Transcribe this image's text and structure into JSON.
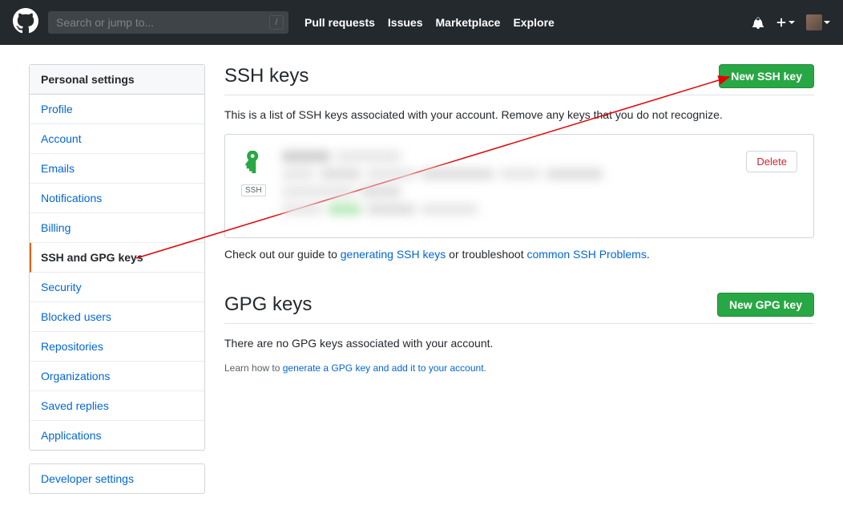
{
  "header": {
    "search_placeholder": "Search or jump to...",
    "nav": [
      "Pull requests",
      "Issues",
      "Marketplace",
      "Explore"
    ]
  },
  "sidebar": {
    "heading": "Personal settings",
    "items": [
      {
        "label": "Profile",
        "selected": false
      },
      {
        "label": "Account",
        "selected": false
      },
      {
        "label": "Emails",
        "selected": false
      },
      {
        "label": "Notifications",
        "selected": false
      },
      {
        "label": "Billing",
        "selected": false
      },
      {
        "label": "SSH and GPG keys",
        "selected": true
      },
      {
        "label": "Security",
        "selected": false
      },
      {
        "label": "Blocked users",
        "selected": false
      },
      {
        "label": "Repositories",
        "selected": false
      },
      {
        "label": "Organizations",
        "selected": false
      },
      {
        "label": "Saved replies",
        "selected": false
      },
      {
        "label": "Applications",
        "selected": false
      }
    ],
    "secondary_items": [
      {
        "label": "Developer settings"
      }
    ]
  },
  "ssh": {
    "title": "SSH keys",
    "new_button": "New SSH key",
    "description": "This is a list of SSH keys associated with your account. Remove any keys that you do not recognize.",
    "badge": "SSH",
    "delete_button": "Delete",
    "guide_prefix": "Check out our guide to ",
    "guide_link_generate": "generating SSH keys",
    "guide_mid": " or troubleshoot ",
    "guide_link_problems": "common SSH Problems",
    "guide_suffix": "."
  },
  "gpg": {
    "title": "GPG keys",
    "new_button": "New GPG key",
    "empty_message": "There are no GPG keys associated with your account.",
    "learn_prefix": "Learn how to ",
    "learn_link": "generate a GPG key and add it to your account",
    "learn_suffix": "."
  }
}
